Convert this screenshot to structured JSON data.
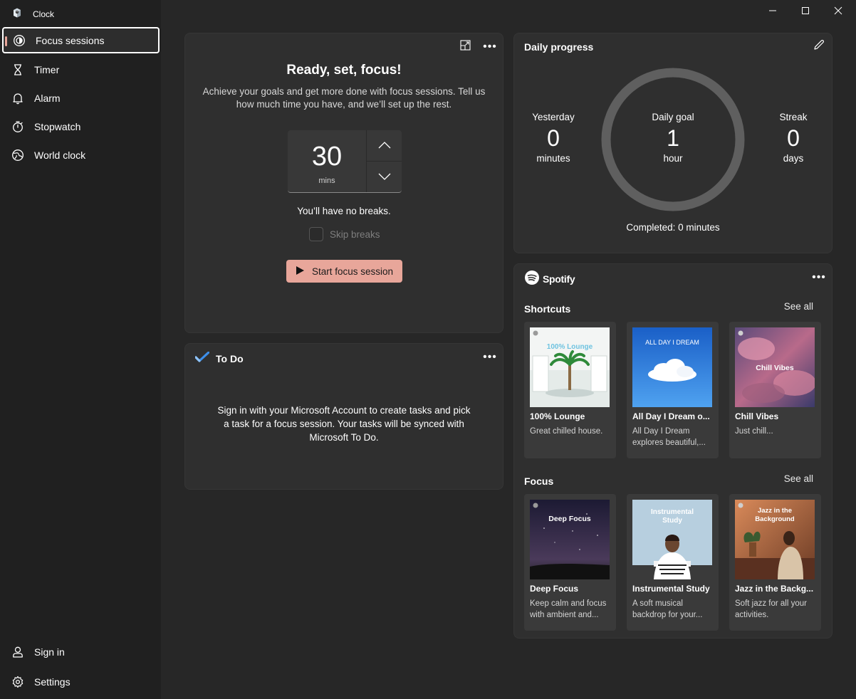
{
  "app": {
    "title": "Clock",
    "icon": "clock-app-icon"
  },
  "sidebar": {
    "items": [
      {
        "label": "Focus sessions",
        "icon": "focus-icon",
        "active": true
      },
      {
        "label": "Timer",
        "icon": "hourglass-icon"
      },
      {
        "label": "Alarm",
        "icon": "bell-icon"
      },
      {
        "label": "Stopwatch",
        "icon": "stopwatch-icon"
      },
      {
        "label": "World clock",
        "icon": "globe-icon"
      }
    ],
    "bottom": [
      {
        "label": "Sign in",
        "icon": "person-icon"
      },
      {
        "label": "Settings",
        "icon": "gear-icon"
      }
    ]
  },
  "focus": {
    "title": "Ready, set, focus!",
    "description": "Achieve your goals and get more done with focus sessions. Tell us how much time you have, and we’ll set up the rest.",
    "minutes": "30",
    "unit": "mins",
    "breaks_text": "You’ll have no breaks.",
    "skip_label": "Skip breaks",
    "start_label": "Start focus session"
  },
  "todo": {
    "title": "To Do",
    "message": "Sign in with your Microsoft Account to create tasks and pick a task for a focus session. Your tasks will be synced with Microsoft To Do."
  },
  "daily_progress": {
    "title": "Daily progress",
    "yesterday": {
      "label": "Yesterday",
      "value": "0",
      "unit": "minutes"
    },
    "goal": {
      "label": "Daily goal",
      "value": "1",
      "unit": "hour"
    },
    "streak": {
      "label": "Streak",
      "value": "0",
      "unit": "days"
    },
    "completed": "Completed: 0 minutes",
    "progress_fraction": 0
  },
  "spotify": {
    "brand": "Spotify",
    "shortcuts": {
      "title": "Shortcuts",
      "see_all": "See all",
      "items": [
        {
          "name": "100% Lounge",
          "desc": "Great chilled house.",
          "art_text": "100% Lounge"
        },
        {
          "name": "All Day I Dream o...",
          "desc": "All Day I Dream explores beautiful,...",
          "art_text": "ALL DAY I DREAM"
        },
        {
          "name": "Chill Vibes",
          "desc": "Just chill...",
          "art_text": "Chill Vibes"
        }
      ]
    },
    "focus": {
      "title": "Focus",
      "see_all": "See all",
      "items": [
        {
          "name": "Deep Focus",
          "desc": "Keep calm and focus with ambient and...",
          "art_text": "Deep Focus"
        },
        {
          "name": "Instrumental Study",
          "desc": "A soft musical backdrop for your...",
          "art_text": "Instrumental Study"
        },
        {
          "name": "Jazz in the Backg...",
          "desc": "Soft jazz for all your activities.",
          "art_text": "Jazz in the Background"
        }
      ]
    }
  },
  "colors": {
    "accent": "#e8a69a",
    "background": "#272727",
    "sidebar": "#202020",
    "card": "#2f2f2f"
  }
}
